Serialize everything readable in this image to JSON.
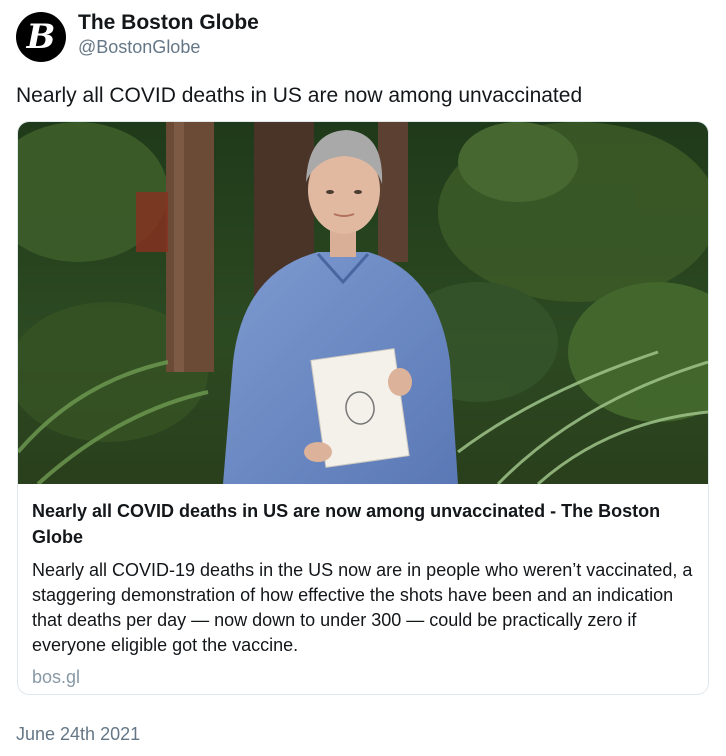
{
  "account": {
    "avatar_letter": "B",
    "display_name": "The Boston Globe",
    "handle": "@BostonGlobe"
  },
  "tweet": {
    "text": "Nearly all COVID deaths in US are now among unvaccinated",
    "date": "June 24th 2021"
  },
  "card": {
    "image_icon": "photo-woman-holding-book-in-forest",
    "title": "Nearly all COVID deaths in US are now among unvaccinated - The Boston Globe",
    "description": "Nearly all COVID-19 deaths in the US now are in people who weren’t vaccinated, a staggering demonstration of how effective the shots have been and an indication that deaths per day — now down to under 300 — could be practically zero if everyone eligible got the vaccine.",
    "domain": "bos.gl"
  },
  "colors": {
    "text": "#14171a",
    "secondary": "#657786",
    "domain": "#8899a6",
    "border": "#e1e8ed"
  }
}
